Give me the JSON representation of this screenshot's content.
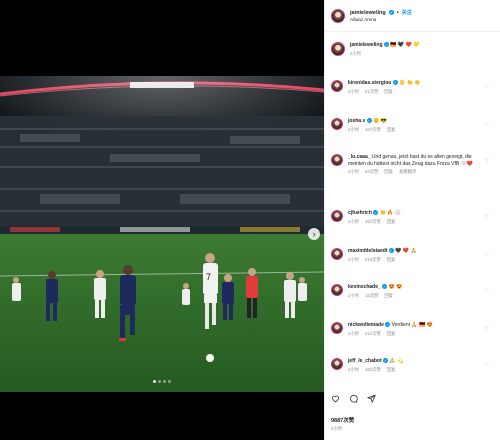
{
  "post": {
    "username": "jamieleweling",
    "location": "Allianz Arena",
    "follow_label": "关注"
  },
  "caption": {
    "username": "jamieleweling",
    "emojis": "🇩🇪 🖤 ❤️ 💛",
    "time": "2小时"
  },
  "comments": [
    {
      "user": "kironidas.stergiou",
      "text": "🖐️ 👏 👏",
      "time": "4小时",
      "likes": "21次赞",
      "reply": "回复",
      "multiline": false
    },
    {
      "user": "josha.v",
      "text": "🫡 😎",
      "time": "2小时",
      "likes": "167次赞",
      "reply": "回复",
      "multiline": false
    },
    {
      "user": "_lu.caaa_",
      "text": "Und genau, jetzt hast du es allen gezeigt, die meinten du hättest nicht das Zeug dazu Forza VfB 🤍❤️",
      "time": "2小时",
      "likes": "63次赞",
      "reply": "回复",
      "extra": "查看翻译",
      "multiline": true
    },
    {
      "user": "cjfuehrich",
      "text": "👏 🔥 ⚪",
      "time": "2小时",
      "likes": "257次赞",
      "reply": "回复",
      "multiline": false
    },
    {
      "user": "maximittelstaedt",
      "text": "🖤 ❤️ 🙏",
      "time": "2小时",
      "likes": "210次赞",
      "reply": "回复",
      "multiline": false
    },
    {
      "user": "kevinschade_",
      "text": "😍 😍",
      "time": "2小时",
      "likes": "15次赞",
      "reply": "回复",
      "multiline": false
    },
    {
      "user": "nickwoltemade",
      "text": "Verdient 🙏 🇩🇪 😍",
      "time": "2小时",
      "likes": "221次赞",
      "reply": "回复",
      "multiline": false
    },
    {
      "user": "jeff_le_chabot",
      "text": "🙏 💫",
      "time": "2小时",
      "likes": "192次赞",
      "reply": "回复",
      "multiline": false
    }
  ],
  "footer": {
    "likes": "9887次赞",
    "date": "2小时"
  },
  "colors": {
    "accent": "#0095f6",
    "pitch": "#2f6e2a",
    "stand_light": "#e23a55"
  },
  "carousel": {
    "count": 4,
    "active": 0
  }
}
